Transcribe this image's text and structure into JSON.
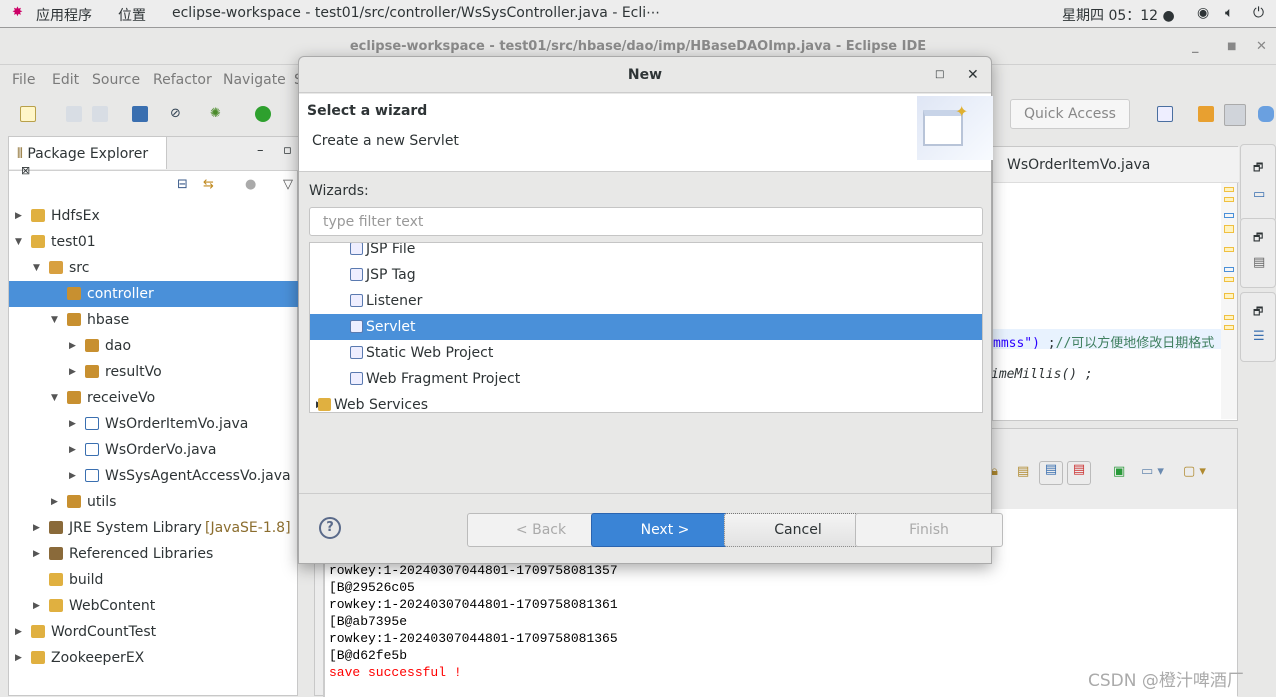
{
  "topbar": {
    "apps": "应用程序",
    "places": "位置",
    "window": "eclipse-workspace - test01/src/controller/WsSysController.java - Ecli⋯",
    "clock": "星期四 05：12 ●"
  },
  "window": {
    "title": "eclipse-workspace - test01/src/hbase/dao/imp/HBaseDAOImp.java - Eclipse IDE"
  },
  "menu": [
    "File",
    "Edit",
    "Source",
    "Refactor",
    "Navigate",
    "S"
  ],
  "quick_access": "Quick Access",
  "package_explorer": {
    "tab": "Package Explorer",
    "tree": [
      {
        "label": "HdfsEx",
        "level": 0,
        "twisty": "right",
        "icon": "project"
      },
      {
        "label": "test01",
        "level": 0,
        "twisty": "down",
        "icon": "project"
      },
      {
        "label": "src",
        "level": 1,
        "twisty": "down",
        "icon": "source-folder"
      },
      {
        "label": "controller",
        "level": 2,
        "twisty": "",
        "icon": "package",
        "selected": true
      },
      {
        "label": "hbase",
        "level": 2,
        "twisty": "down",
        "icon": "package"
      },
      {
        "label": "dao",
        "level": 3,
        "twisty": "right",
        "icon": "package"
      },
      {
        "label": "resultVo",
        "level": 3,
        "twisty": "right",
        "icon": "package"
      },
      {
        "label": "receiveVo",
        "level": 2,
        "twisty": "down",
        "icon": "package"
      },
      {
        "label": "WsOrderItemVo.java",
        "level": 3,
        "twisty": "right",
        "icon": "java-file"
      },
      {
        "label": "WsOrderVo.java",
        "level": 3,
        "twisty": "right",
        "icon": "java-file"
      },
      {
        "label": "WsSysAgentAccessVo.java",
        "level": 3,
        "twisty": "right",
        "icon": "java-file"
      },
      {
        "label": "utils",
        "level": 2,
        "twisty": "right",
        "icon": "package"
      },
      {
        "label": "JRE System Library",
        "suffix": "[JavaSE-1.8]",
        "level": 1,
        "twisty": "right",
        "icon": "library"
      },
      {
        "label": "Referenced Libraries",
        "level": 1,
        "twisty": "right",
        "icon": "library"
      },
      {
        "label": "build",
        "level": 1,
        "twisty": "",
        "icon": "folder"
      },
      {
        "label": "WebContent",
        "level": 1,
        "twisty": "right",
        "icon": "folder"
      },
      {
        "label": "WordCountTest",
        "level": 0,
        "twisty": "right",
        "icon": "project"
      },
      {
        "label": "ZookeeperEX",
        "level": 0,
        "twisty": "right",
        "icon": "project"
      }
    ]
  },
  "editor": {
    "tab": "WsOrderItemVo.java",
    "line1_str": "mmss\")",
    "line1_rest": " ;",
    "line1_comment": "//可以方便地修改日期格式",
    "line2": "imeMillis() ;"
  },
  "console": {
    "lines": [
      {
        "text": "rowkey:1-20240307044801-1709758081357",
        "color": "#000000"
      },
      {
        "text": "[B@29526c05",
        "color": "#000000"
      },
      {
        "text": "rowkey:1-20240307044801-1709758081361",
        "color": "#000000"
      },
      {
        "text": "[B@ab7395e",
        "color": "#000000"
      },
      {
        "text": "rowkey:1-20240307044801-1709758081365",
        "color": "#000000"
      },
      {
        "text": "[B@d62fe5b",
        "color": "#000000"
      },
      {
        "text": "save successful !",
        "color": "#ff0000"
      }
    ]
  },
  "dialog": {
    "title": "New",
    "heading": "Select a wizard",
    "subheading": "Create a new Servlet",
    "wizards_label": "Wizards:",
    "filter_placeholder": "type filter text",
    "items": [
      {
        "label": "JSP File",
        "indent": 1,
        "icon": "jsp-file"
      },
      {
        "label": "JSP Tag",
        "indent": 1,
        "icon": "jsp-tag"
      },
      {
        "label": "Listener",
        "indent": 1,
        "icon": "listener"
      },
      {
        "label": "Servlet",
        "indent": 1,
        "icon": "servlet",
        "selected": true
      },
      {
        "label": "Static Web Project",
        "indent": 1,
        "icon": "web-project"
      },
      {
        "label": "Web Fragment Project",
        "indent": 1,
        "icon": "web-fragment"
      },
      {
        "label": "Web Services",
        "indent": 0,
        "icon": "folder",
        "twisty": "right"
      }
    ],
    "buttons": {
      "back": "< Back",
      "next": "Next >",
      "cancel": "Cancel",
      "finish": "Finish"
    }
  },
  "watermark": "CSDN @橙汁啤酒厂",
  "colors": {
    "selection": "#4a90d9",
    "primary_button": "#3a84d6",
    "error_text": "#ff0000"
  }
}
